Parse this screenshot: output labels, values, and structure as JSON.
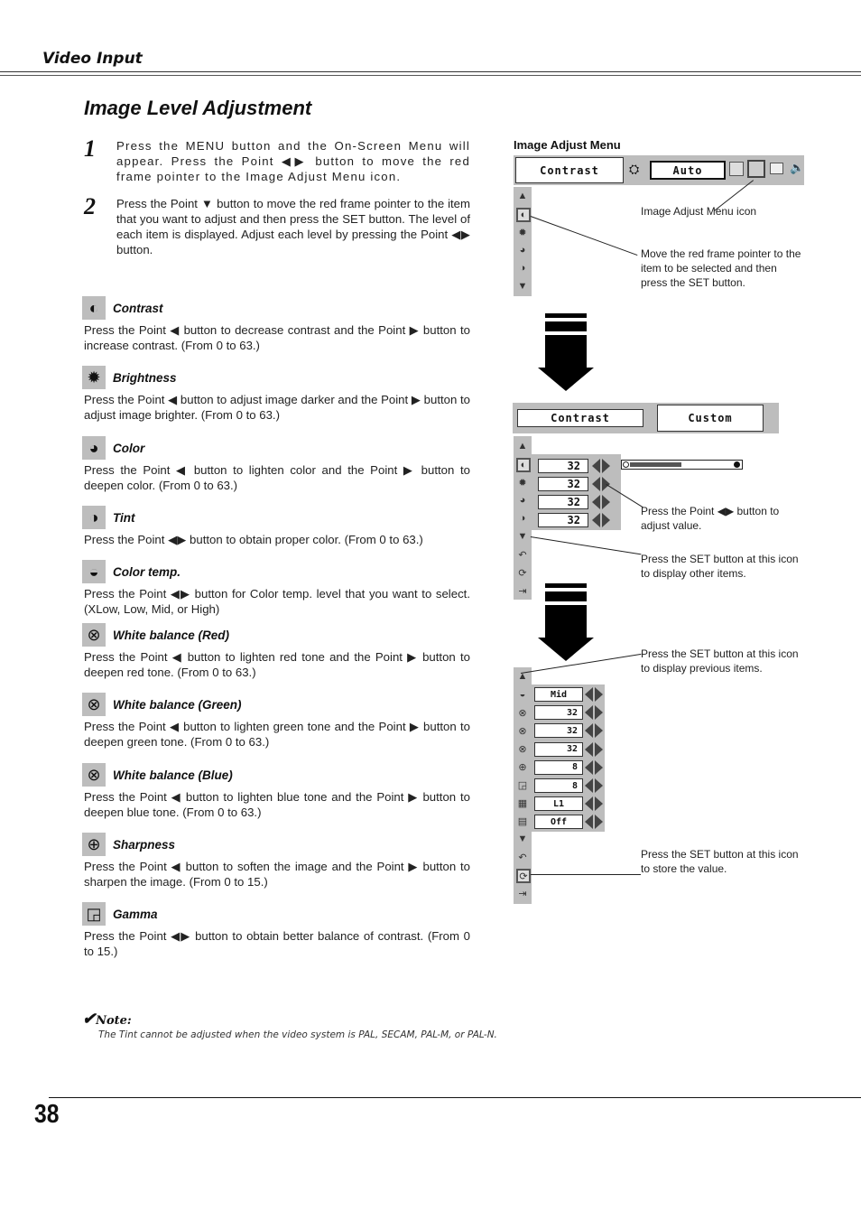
{
  "header": {
    "section_title": "Video Input",
    "page_heading": "Image Level Adjustment"
  },
  "steps": [
    {
      "number": "1",
      "text": "Press the MENU button and the On-Screen Menu will appear.  Press the Point ◀▶ button to move the red frame pointer to the Image Adjust Menu icon."
    },
    {
      "number": "2",
      "text": "Press the Point ▼ button to move the red frame pointer to the item that you want to adjust and then press the SET button.  The level of each item is displayed.  Adjust each level by pressing the Point ◀▶ button."
    }
  ],
  "items": [
    {
      "icon": "contrast-icon",
      "glyph": "◐",
      "title": "Contrast",
      "desc": "Press the Point ◀ button to decrease contrast and the Point ▶ button to increase contrast.  (From 0 to 63.)"
    },
    {
      "icon": "brightness-icon",
      "glyph": "✹",
      "title": "Brightness",
      "desc": "Press the Point ◀ button to adjust image darker and the Point ▶ button to adjust image brighter.  (From 0 to 63.)"
    },
    {
      "icon": "color-icon",
      "glyph": "◕",
      "title": "Color",
      "desc": "Press the Point ◀ button to lighten color and the Point ▶ button to deepen color.  (From 0 to 63.)"
    },
    {
      "icon": "tint-icon",
      "glyph": "◑",
      "title": "Tint",
      "desc": "Press the Point ◀▶ button to obtain proper color.  (From 0 to 63.)"
    },
    {
      "icon": "color-temp-icon",
      "glyph": "◒",
      "title": "Color temp.",
      "desc": "Press the Point ◀▶ button for Color temp. level that you want to select. (XLow, Low, Mid, or High)"
    },
    {
      "icon": "white-balance-red-icon",
      "glyph": "⊗",
      "title": "White balance (Red)",
      "desc": "Press the Point ◀ button to lighten red tone and the Point ▶ button to deepen red tone.  (From 0 to 63.)"
    },
    {
      "icon": "white-balance-green-icon",
      "glyph": "⊗",
      "title": "White balance (Green)",
      "desc": "Press the Point ◀ button to lighten green tone and the Point ▶ button to deepen green tone.  (From 0 to 63.)"
    },
    {
      "icon": "white-balance-blue-icon",
      "glyph": "⊗",
      "title": "White balance (Blue)",
      "desc": "Press the Point ◀ button to lighten blue tone and the Point ▶ button to deepen blue tone.  (From 0 to 63.)"
    },
    {
      "icon": "sharpness-icon",
      "glyph": "⊕",
      "title": "Sharpness",
      "desc": "Press the Point ◀ button to soften the image and the Point ▶ button to sharpen the image.  (From 0 to 15.)"
    },
    {
      "icon": "gamma-icon",
      "glyph": "◲",
      "title": "Gamma",
      "desc": "Press the Point ◀▶ button to obtain better balance of contrast. (From 0 to 15.)"
    }
  ],
  "note": {
    "label": "Note:",
    "text": "The Tint cannot be adjusted when the video system is PAL, SECAM, PAL-M, or PAL-N."
  },
  "footer": {
    "page_number": "38"
  },
  "figure1": {
    "title": "Image Adjust Menu",
    "menu_item": "Contrast",
    "mode": "Auto",
    "annotations": {
      "menu_icon": "Image Adjust Menu icon",
      "pointer": "Move the red frame pointer to the item to be selected and then press the SET button."
    }
  },
  "figure2": {
    "menu_item": "Contrast",
    "mode": "Custom",
    "values": [
      "32",
      "32",
      "32",
      "32"
    ],
    "slider_fraction": 0.5,
    "annotations": {
      "adjust": "Press the Point ◀▶ button to adjust value.",
      "next": "Press the SET button at this icon to display other items."
    }
  },
  "figure3": {
    "values": [
      "Mid",
      "32",
      "32",
      "32",
      "8",
      "8",
      "L1",
      "Off"
    ],
    "annotations": {
      "previous": "Press the SET button at this icon to display previous items.",
      "store": "Press the SET button at this icon to store the value."
    }
  }
}
